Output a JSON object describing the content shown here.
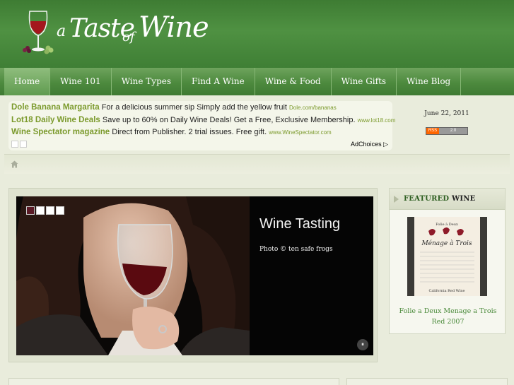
{
  "site": {
    "logo_a": "a",
    "logo_taste": "Taste",
    "logo_of": "of",
    "logo_wine": "Wine"
  },
  "nav": {
    "items": [
      {
        "label": "Home"
      },
      {
        "label": "Wine 101"
      },
      {
        "label": "Wine Types"
      },
      {
        "label": "Find A Wine"
      },
      {
        "label": "Wine & Food"
      },
      {
        "label": "Wine Gifts"
      },
      {
        "label": "Wine Blog"
      }
    ],
    "active": "Home"
  },
  "ads": {
    "items": [
      {
        "title": "Dole Banana Margarita",
        "text": "For a delicious summer sip Simply add the yellow fruit",
        "url": "Dole.com/bananas"
      },
      {
        "title": "Lot18 Daily Wine Deals",
        "text": "Save up to 60% on Daily Wine Deals! Get a Free, Exclusive Membership.",
        "url": "www.lot18.com"
      },
      {
        "title": "Wine Spectator magazine",
        "text": "Direct from Publisher. 2 trial issues. Free gift.",
        "url": "www.WineSpectator.com"
      }
    ],
    "adchoices_label": "AdChoices ▷"
  },
  "sidebar_top": {
    "date": "June 22, 2011",
    "rss_left": "RSS",
    "rss_right": "2.0"
  },
  "slider": {
    "title": "Wine Tasting",
    "credit": "Photo © ten safe frogs",
    "pause_glyph": "⏸",
    "slide_count": 4,
    "active_index": 0
  },
  "featured": {
    "heading_main": "FEATURED",
    "heading_accent": "WINE",
    "caption": "Folie a Deux Menage a Trois Red 2007",
    "label_top": "Folie à Deux",
    "label_name": "Ménage à Trois",
    "label_bottom": "California Red Wine"
  },
  "colors": {
    "header_green": "#4f9142",
    "nav_green": "#4d8a3e",
    "link_green": "#4a8a3a",
    "ad_title": "#7b9a2c",
    "background": "#e9ecdc"
  }
}
